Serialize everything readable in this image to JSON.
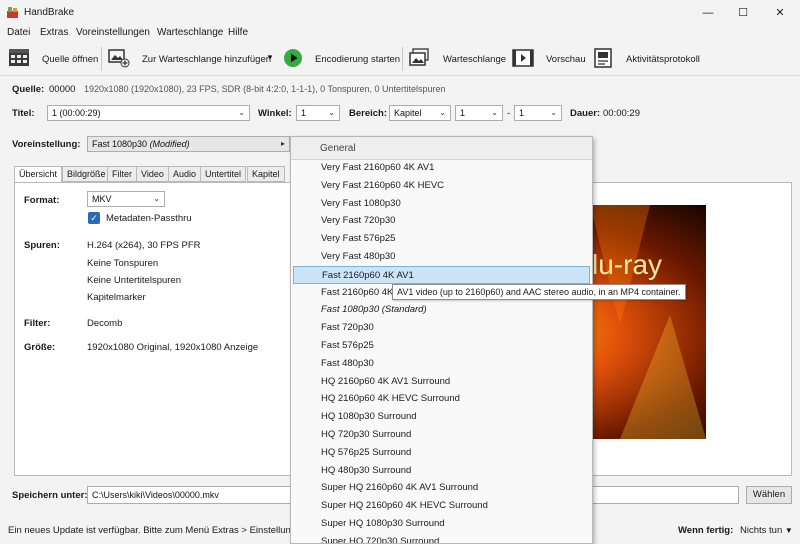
{
  "window": {
    "title": "HandBrake"
  },
  "menu": [
    "Datei",
    "Extras",
    "Voreinstellungen",
    "Warteschlange",
    "Hilfe"
  ],
  "toolbar": {
    "open_source": "Quelle öffnen",
    "add_queue": "Zur Warteschlange hinzufügen",
    "start_encode": "Encodierung starten",
    "queue": "Warteschlange",
    "preview": "Vorschau",
    "activity_log": "Aktivitätsprotokoll"
  },
  "source": {
    "label": "Quelle:",
    "name": "00000",
    "info": "1920x1080 (1920x1080), 23 FPS, SDR (8-bit 4:2:0, 1-1-1), 0 Tonspuren, 0 Untertitelspuren"
  },
  "title_row": {
    "title_label": "Titel:",
    "title_value": "1 (00:00:29)",
    "angle_label": "Winkel:",
    "angle_value": "1",
    "range_label": "Bereich:",
    "range_type": "Kapitel",
    "range_start": "1",
    "range_dash": "-",
    "range_end": "1",
    "duration_label": "Dauer:",
    "duration_value": "00:00:29"
  },
  "preset": {
    "label": "Voreinstellung:",
    "value": "Fast 1080p30",
    "modified": "(Modified)"
  },
  "tabs": [
    "Übersicht",
    "Bildgröße",
    "Filter",
    "Video",
    "Audio",
    "Untertitel",
    "Kapitel"
  ],
  "summary": {
    "format_label": "Format:",
    "format_value": "MKV",
    "passthru_label": "Metadaten-Passthru",
    "tracks_label": "Spuren:",
    "tracks": [
      "H.264 (x264), 30 FPS PFR",
      "Keine Tonspuren",
      "Keine Untertitelspuren",
      "Kapitelmarker"
    ],
    "filter_label": "Filter:",
    "filter_value": "Decomb",
    "size_label": "Größe:",
    "size_value": "1920x1080 Original, 1920x1080 Anzeige"
  },
  "preview_text": "lu-ray",
  "dropdown": {
    "header": "General",
    "items": [
      "Very Fast 2160p60 4K AV1",
      "Very Fast 2160p60 4K HEVC",
      "Very Fast 1080p30",
      "Very Fast 720p30",
      "Very Fast 576p25",
      "Very Fast 480p30",
      "Fast 2160p60 4K AV1",
      "Fast 2160p60 4K HEVC",
      "Fast 1080p30 (Standard)",
      "Fast 720p30",
      "Fast 576p25",
      "Fast 480p30",
      "HQ 2160p60 4K AV1 Surround",
      "HQ 2160p60 4K HEVC Surround",
      "HQ 1080p30 Surround",
      "HQ 720p30 Surround",
      "HQ 576p25 Surround",
      "HQ 480p30 Surround",
      "Super HQ 2160p60 4K AV1 Surround",
      "Super HQ 2160p60 4K HEVC Surround",
      "Super HQ 1080p30 Surround",
      "Super HQ 720p30 Surround"
    ],
    "highlighted": "Fast 2160p60 4K AV1",
    "tooltip": "AV1 video (up to 2160p60) and AAC stereo audio, in an MP4 container."
  },
  "save": {
    "label": "Speichern unter:",
    "path": "C:\\Users\\kiki\\Videos\\00000.mkv",
    "browse": "Wählen"
  },
  "status": {
    "message": "Ein neues Update ist verfügbar. Bitte zum Menü Extras  > Einstellungen",
    "when_done_label": "Wenn fertig:",
    "when_done_value": "Nichts tun"
  },
  "colors": {
    "accent": "#2a6bb5",
    "highlight": "#cce4f7",
    "start_green": "#3aa845"
  }
}
